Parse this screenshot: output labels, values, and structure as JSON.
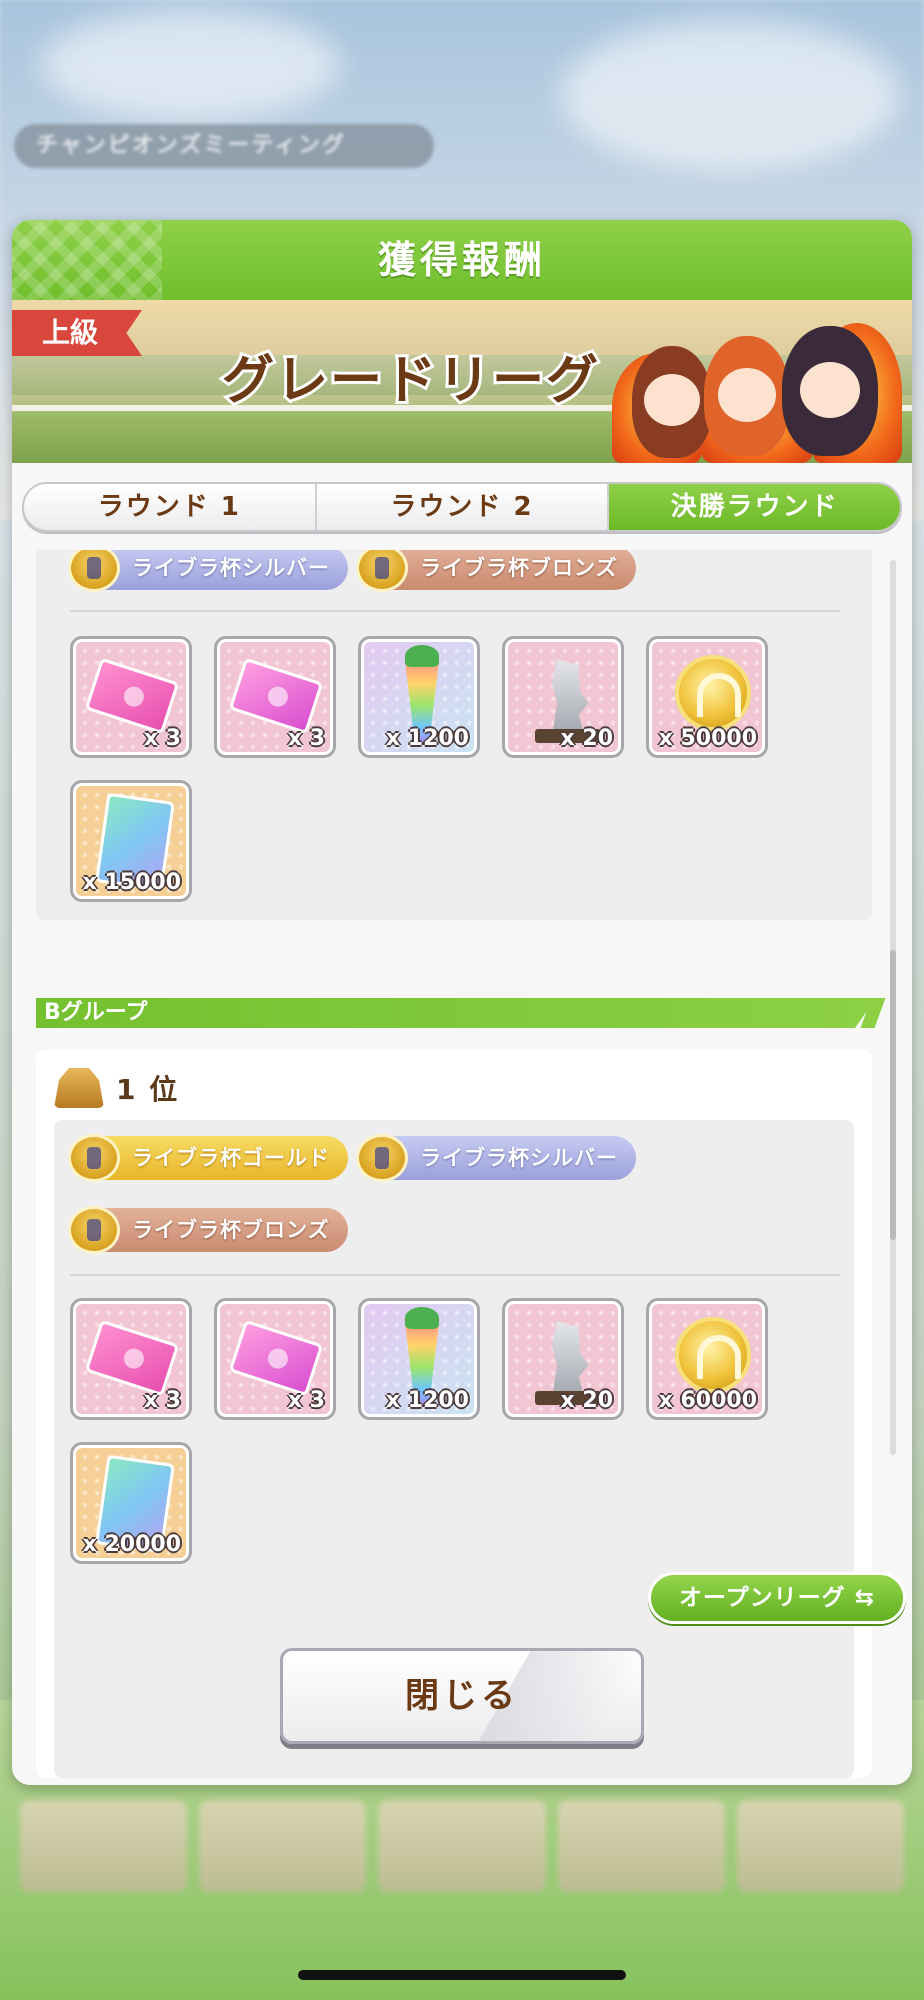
{
  "background": {
    "event_label": "チャンピオンズミーティング"
  },
  "modal": {
    "title": "獲得報酬",
    "banner_badge": "上級",
    "banner_title": "グレードリーグ",
    "tabs": [
      {
        "label": "ラウンド 1",
        "active": false
      },
      {
        "label": "ラウンド 2",
        "active": false
      },
      {
        "label": "決勝ラウンド",
        "active": true
      }
    ],
    "group_a_partial": {
      "trophies": [
        {
          "label": "ライブラ杯シルバー",
          "tier": "silver"
        },
        {
          "label": "ライブラ杯ブロンズ",
          "tier": "bronze"
        }
      ],
      "items": [
        {
          "icon": "pink-ticket-icon",
          "qty": "x 3"
        },
        {
          "icon": "magenta-ticket-icon",
          "qty": "x 3"
        },
        {
          "icon": "rainbow-carrot-icon",
          "qty": "x 1200"
        },
        {
          "icon": "horse-statue-icon",
          "qty": "x 20"
        },
        {
          "icon": "gold-coin-icon",
          "qty": "x 50000"
        },
        {
          "icon": "uma-piece-icon",
          "qty": "x 15000"
        }
      ]
    },
    "group_b": {
      "label": "Bグループ",
      "rank_label": "1 位",
      "trophies": [
        {
          "label": "ライブラ杯ゴールド",
          "tier": "gold"
        },
        {
          "label": "ライブラ杯シルバー",
          "tier": "silver"
        },
        {
          "label": "ライブラ杯ブロンズ",
          "tier": "bronze"
        }
      ],
      "items": [
        {
          "icon": "pink-ticket-icon",
          "qty": "x 3"
        },
        {
          "icon": "magenta-ticket-icon",
          "qty": "x 3"
        },
        {
          "icon": "rainbow-carrot-icon",
          "qty": "x 1200"
        },
        {
          "icon": "horse-statue-icon",
          "qty": "x 20"
        },
        {
          "icon": "gold-coin-icon",
          "qty": "x 60000"
        },
        {
          "icon": "uma-piece-icon",
          "qty": "x 20000"
        }
      ]
    },
    "open_league_button": "オープンリーグ ⇆",
    "close_button": "閉じる"
  },
  "colors": {
    "accent_green": "#6fbf2c",
    "title_brown": "#6b3a14",
    "badge_red": "#d9463b"
  }
}
